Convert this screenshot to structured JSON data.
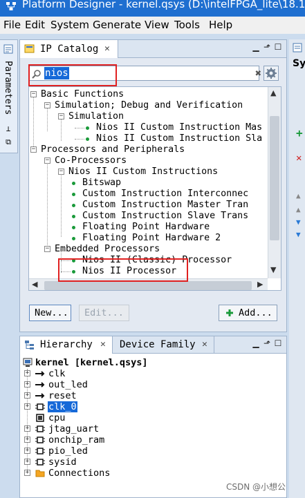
{
  "window": {
    "title": "Platform Designer - kernel.qsys (D:\\intelFPGA_lite\\18.1\\ke"
  },
  "menu": [
    "File",
    "Edit",
    "System",
    "Generate",
    "View",
    "Tools",
    "Help"
  ],
  "left_strip": {
    "label": "Parameters"
  },
  "ip_catalog": {
    "tab_label": "IP Catalog",
    "tab_close": "✕",
    "search_value": "nios",
    "tree": [
      {
        "label": "Basic Functions",
        "level": 0,
        "type": "folder"
      },
      {
        "label": "Simulation; Debug and Verification",
        "level": 1,
        "type": "folder"
      },
      {
        "label": "Simulation",
        "level": 2,
        "type": "folder"
      },
      {
        "label": "Nios II Custom Instruction Mas",
        "level": 3,
        "type": "item"
      },
      {
        "label": "Nios II Custom Instruction Sla",
        "level": 3,
        "type": "item"
      },
      {
        "label": "Processors and Peripherals",
        "level": 0,
        "type": "folder"
      },
      {
        "label": "Co-Processors",
        "level": 1,
        "type": "folder"
      },
      {
        "label": "Nios II Custom Instructions",
        "level": 2,
        "type": "folder"
      },
      {
        "label": "Bitswap",
        "level": 3,
        "type": "item"
      },
      {
        "label": "Custom Instruction Interconnec",
        "level": 3,
        "type": "item"
      },
      {
        "label": "Custom Instruction Master Tran",
        "level": 3,
        "type": "item"
      },
      {
        "label": "Custom Instruction Slave Trans",
        "level": 3,
        "type": "item"
      },
      {
        "label": "Floating Point Hardware",
        "level": 3,
        "type": "item"
      },
      {
        "label": "Floating Point Hardware 2",
        "level": 3,
        "type": "item"
      },
      {
        "label": "Embedded Processors",
        "level": 1,
        "type": "folder"
      },
      {
        "label": "Nios II (Classic) Processor",
        "level": 2,
        "type": "item"
      },
      {
        "label": "Nios II Processor",
        "level": 2,
        "type": "item"
      }
    ],
    "buttons": {
      "new": "New...",
      "edit": "Edit...",
      "add": "Add..."
    }
  },
  "hierarchy": {
    "tab_label": "Hierarchy",
    "tab2_label": "Device Family",
    "tab_close": "✕",
    "root": "kernel [kernel.qsys]",
    "items": [
      {
        "label": "clk",
        "icon": "wire-icon"
      },
      {
        "label": "out_led",
        "icon": "wire-icon"
      },
      {
        "label": "reset",
        "icon": "wire-icon"
      },
      {
        "label": "clk_0",
        "icon": "component-icon",
        "selected": true
      },
      {
        "label": "cpu",
        "icon": "chip-icon"
      },
      {
        "label": "jtag_uart",
        "icon": "component-icon"
      },
      {
        "label": "onchip_ram",
        "icon": "component-icon"
      },
      {
        "label": "pio_led",
        "icon": "component-icon"
      },
      {
        "label": "sysid",
        "icon": "component-icon"
      },
      {
        "label": "Connections",
        "icon": "folder-icon"
      }
    ]
  },
  "right_strip": {
    "label": "Sy"
  },
  "watermark": "CSDN @小想公",
  "colors": {
    "accent": "#1f6fd0",
    "selection": "#1669d8",
    "highlight": "#e02020",
    "ok_green": "#1a9a3a"
  }
}
